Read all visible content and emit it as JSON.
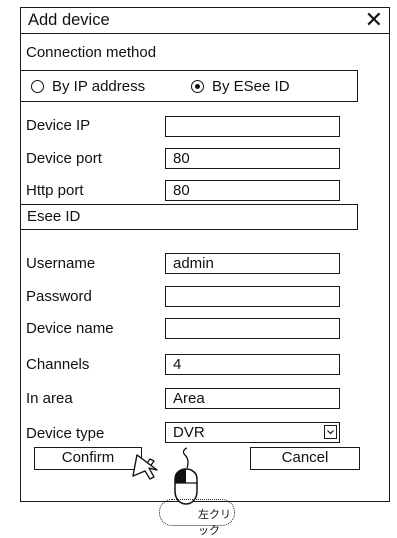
{
  "dialog": {
    "title": "Add device",
    "close_icon": "close-icon"
  },
  "connection": {
    "label": "Connection method",
    "options": [
      "By IP address",
      "By ESee ID"
    ],
    "selected": "By ESee ID"
  },
  "fields": {
    "device_ip": {
      "label": "Device IP",
      "value": ""
    },
    "device_port": {
      "label": "Device port",
      "value": "80"
    },
    "http_port": {
      "label": "Http port",
      "value": "80"
    },
    "esee_id": {
      "label": "Esee ID"
    },
    "username": {
      "label": "Username",
      "value": "admin"
    },
    "password": {
      "label": "Password",
      "value": ""
    },
    "device_name": {
      "label": "Device name",
      "value": ""
    },
    "channels": {
      "label": "Channels",
      "value": "4"
    },
    "in_area": {
      "label": "In area",
      "value": "Area"
    },
    "device_type": {
      "label": "Device type",
      "value": "DVR"
    }
  },
  "buttons": {
    "confirm": "Confirm",
    "cancel": "Cancel"
  },
  "annotation": {
    "click_text": "左クリック",
    "icons": [
      "cursor-arrow-icon",
      "mouse-icon"
    ]
  }
}
